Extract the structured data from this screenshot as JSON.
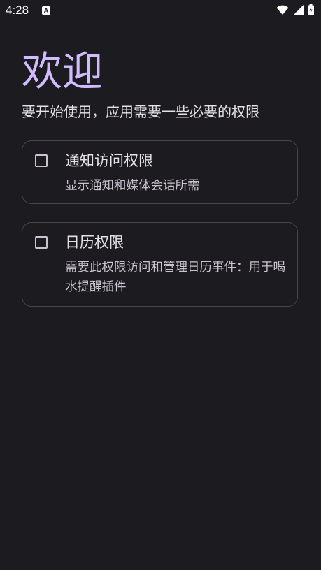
{
  "status_bar": {
    "time": "4:28",
    "notif_glyph": "A",
    "icons": [
      "wifi-icon",
      "signal-icon",
      "battery-icon"
    ]
  },
  "welcome": {
    "title": "欢迎",
    "subtitle": "要开始使用，应用需要一些必要的权限"
  },
  "permissions": [
    {
      "title": "通知访问权限",
      "description": "显示通知和媒体会话所需",
      "checked": false
    },
    {
      "title": "日历权限",
      "description": "需要此权限访问和管理日历事件：用于喝水提醒插件",
      "checked": false
    }
  ],
  "colors": {
    "background": "#1c1b1f",
    "accent": "#d0bcff",
    "text": "#e6e1e5",
    "secondary_text": "#cac4d0",
    "outline": "#49454f"
  }
}
